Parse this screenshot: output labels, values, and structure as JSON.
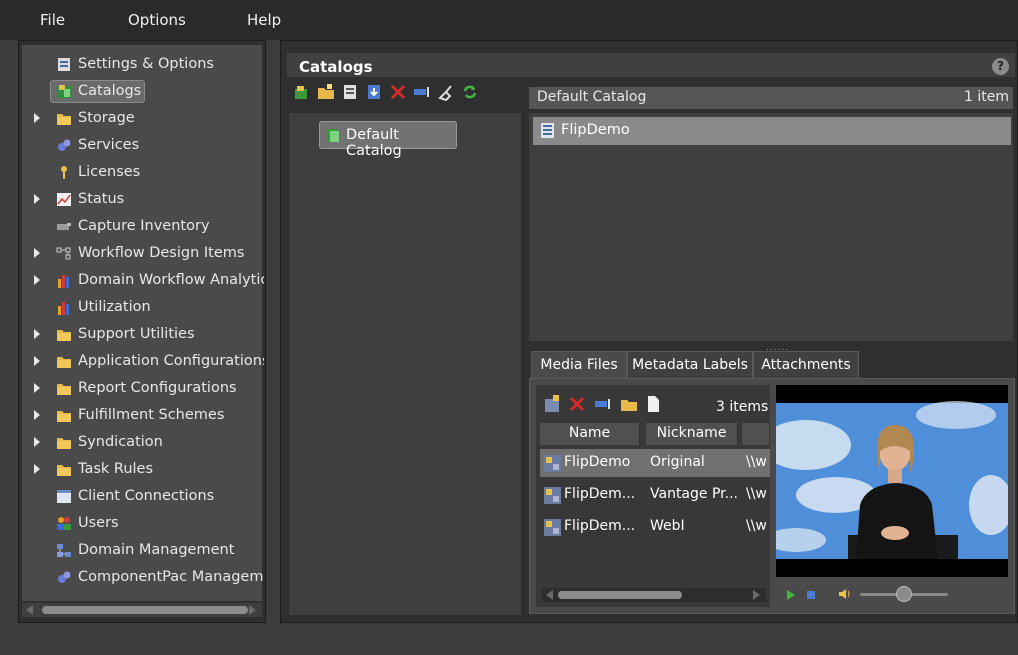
{
  "menu": {
    "file": "File",
    "options": "Options",
    "help": "Help"
  },
  "sidebar": {
    "items": [
      {
        "label": "Settings & Options",
        "expandable": false,
        "icon": "settings-icon"
      },
      {
        "label": "Catalogs",
        "expandable": false,
        "icon": "catalogs-icon",
        "selected": true
      },
      {
        "label": "Storage",
        "expandable": true,
        "icon": "folder-icon"
      },
      {
        "label": "Services",
        "expandable": false,
        "icon": "services-icon"
      },
      {
        "label": "Licenses",
        "expandable": false,
        "icon": "key-icon"
      },
      {
        "label": "Status",
        "expandable": true,
        "icon": "status-chart-icon"
      },
      {
        "label": "Capture Inventory",
        "expandable": false,
        "icon": "capture-icon"
      },
      {
        "label": "Workflow Design Items",
        "expandable": true,
        "icon": "workflow-icon"
      },
      {
        "label": "Domain Workflow Analytic",
        "expandable": true,
        "icon": "bar-chart-icon"
      },
      {
        "label": "Utilization",
        "expandable": false,
        "icon": "bar-chart-icon"
      },
      {
        "label": "Support Utilities",
        "expandable": true,
        "icon": "folder-icon"
      },
      {
        "label": "Application Configurations",
        "expandable": true,
        "icon": "folder-icon"
      },
      {
        "label": "Report Configurations",
        "expandable": true,
        "icon": "folder-icon"
      },
      {
        "label": "Fulfillment Schemes",
        "expandable": true,
        "icon": "folder-icon"
      },
      {
        "label": "Syndication",
        "expandable": true,
        "icon": "folder-icon"
      },
      {
        "label": "Task Rules",
        "expandable": true,
        "icon": "folder-icon"
      },
      {
        "label": "Client Connections",
        "expandable": false,
        "icon": "window-icon"
      },
      {
        "label": "Users",
        "expandable": false,
        "icon": "users-icon"
      },
      {
        "label": "Domain Management",
        "expandable": false,
        "icon": "network-icon"
      },
      {
        "label": "ComponentPac Manageme",
        "expandable": false,
        "icon": "services-icon"
      }
    ]
  },
  "main": {
    "title": "Catalogs",
    "help": "?",
    "toolbar": [
      "new-catalog-icon",
      "new-folder-icon",
      "properties-icon",
      "import-icon",
      "delete-icon",
      "rename-icon",
      "cleanup-icon",
      "refresh-icon"
    ],
    "catalog_tree": {
      "selected": "Default Catalog"
    },
    "list_header": {
      "name": "Default Catalog",
      "count": "1 item"
    },
    "items": [
      "FlipDemo"
    ],
    "tabs": [
      "Media Files",
      "Metadata Labels",
      "Attachments"
    ],
    "active_tab": "Media Files",
    "media": {
      "count": "3 items",
      "columns": [
        "Name",
        "Nickname"
      ],
      "rows": [
        {
          "name": "FlipDemo",
          "nickname": "Original",
          "path": "\\\\w"
        },
        {
          "name": "FlipDem...",
          "nickname": "Vantage Pr...",
          "path": "\\\\w"
        },
        {
          "name": "FlipDem...",
          "nickname": "WebI",
          "path": "\\\\w"
        }
      ]
    },
    "player": {
      "volume_level": 0.45
    }
  },
  "colors": {
    "background": "#3c3c3c",
    "panel": "#4a4a4a",
    "selection": "#727272",
    "accent_green": "#3fb83f",
    "accent_red": "#d42a2a"
  }
}
